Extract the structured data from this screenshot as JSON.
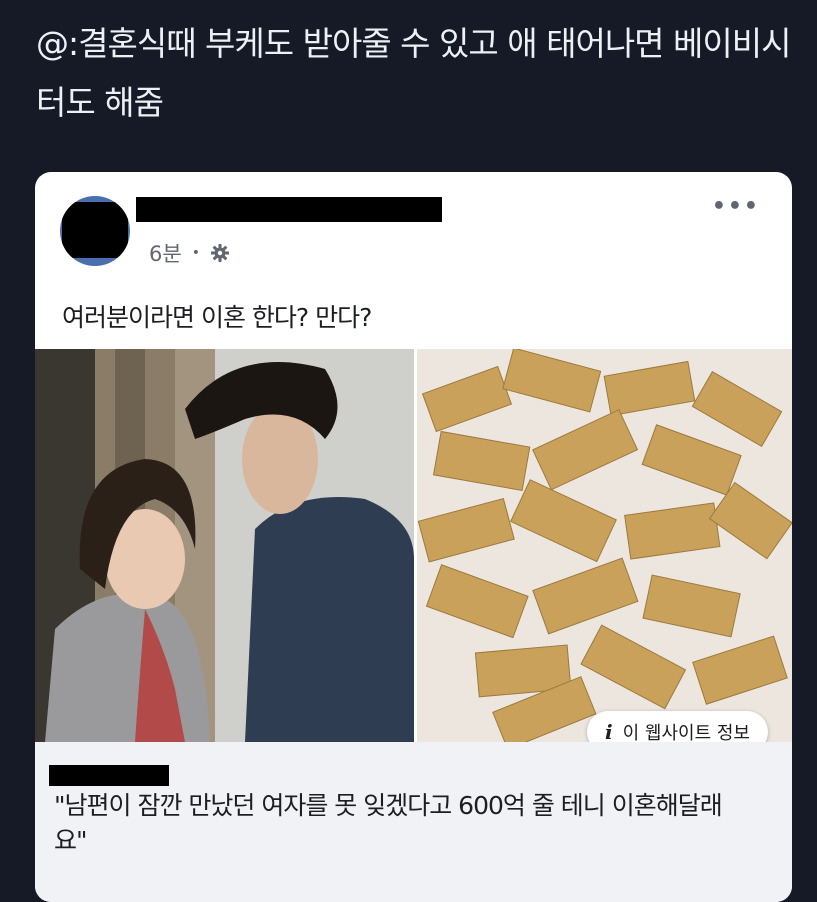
{
  "caption": "@:결혼식때 부케도 받아줄 수 있고 애 태어나면 베이비시터도 해줌",
  "post": {
    "time": "6분",
    "separator": "•",
    "audience_icon": "gear-icon",
    "more_icon": "more-options-icon",
    "more_label": "•••",
    "text": "여러분이라면 이혼 한다? 만다?"
  },
  "link_card": {
    "site_info_label": "이 웹사이트 정보",
    "site_info_icon": "i",
    "headline": "\"남편이 잠깐 만났던 여자를 못 잊겠다고 600억 줄 테니 이혼해달래요\""
  },
  "colors": {
    "background": "#161a26",
    "card": "#ffffff",
    "link_area": "#f0f2f5",
    "meta_text": "#606770",
    "avatar": "#4a6fb0"
  }
}
